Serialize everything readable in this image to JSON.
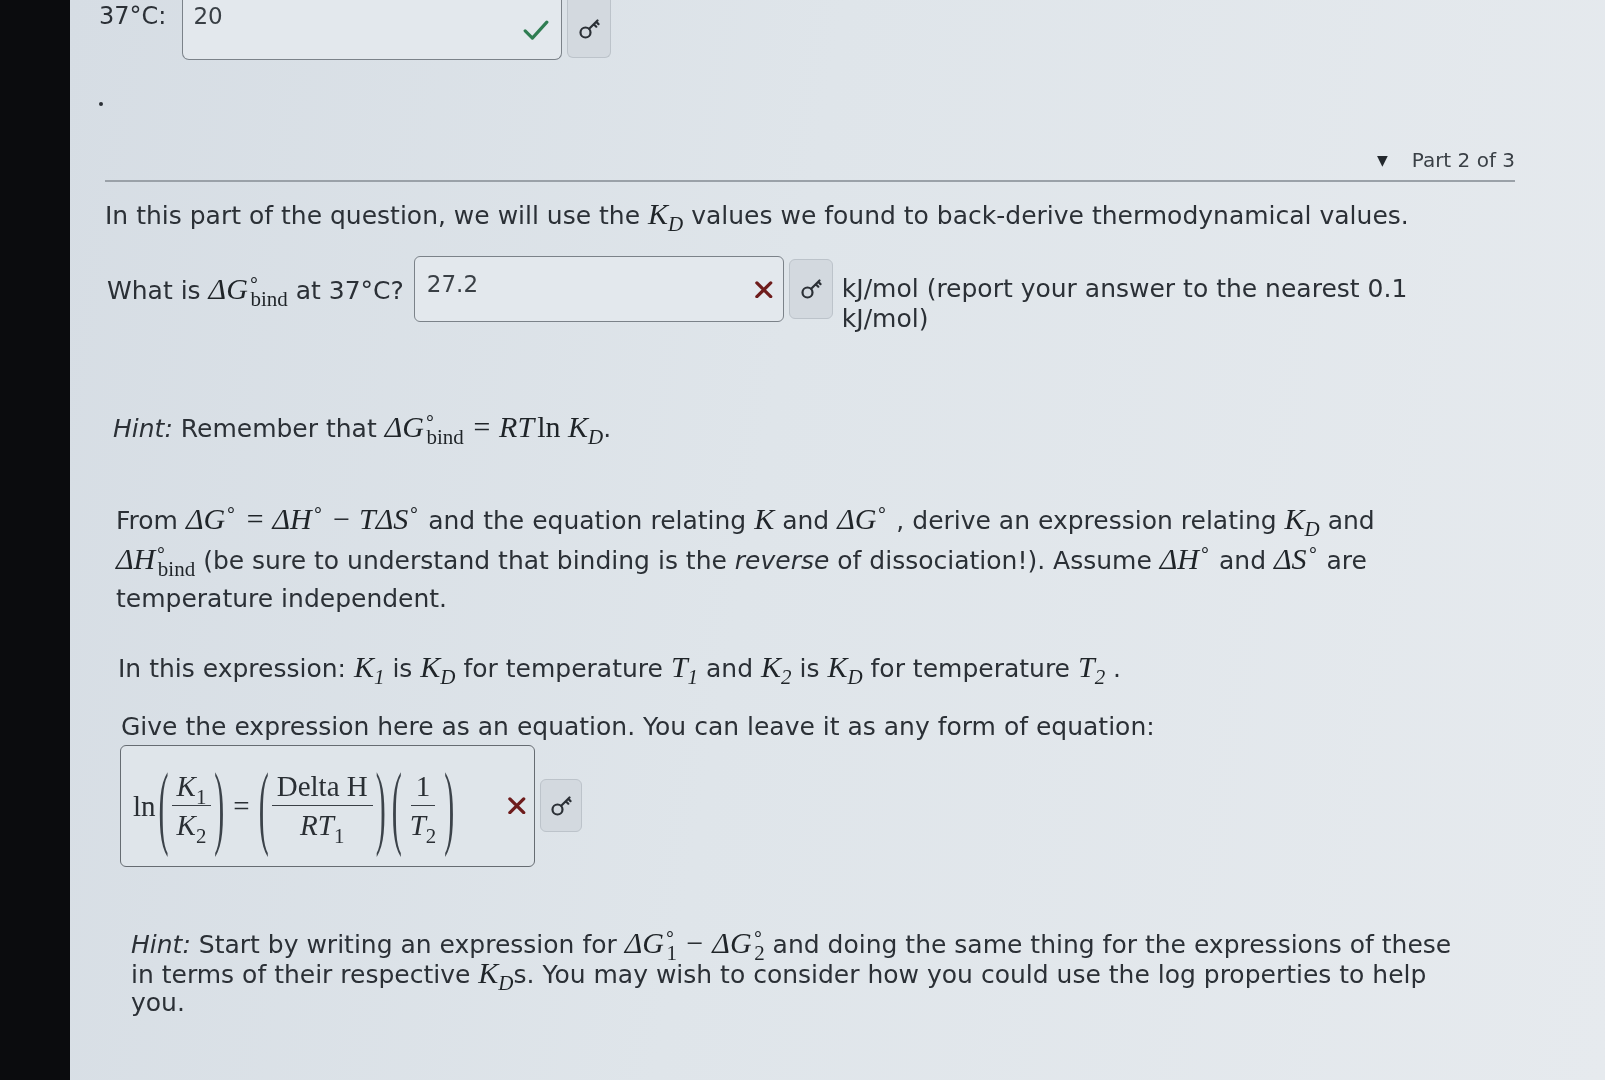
{
  "previous_answer": {
    "label": "37°C:",
    "value": "20",
    "correct": true
  },
  "part_header": {
    "toggle": "▼",
    "label": "Part 2 of 3"
  },
  "intro": [
    {
      "kind": "text",
      "text": "In this part of the question, we will use the "
    },
    {
      "kind": "math",
      "text": "K$_{D}$"
    },
    {
      "kind": "text",
      "text": " values we found to back-derive thermodynamical values."
    }
  ],
  "question": {
    "prompt": [
      {
        "kind": "text",
        "text": "What is "
      },
      {
        "kind": "math",
        "text": "ΔG$^{∘}$$_{bind}$"
      },
      {
        "kind": "text",
        "text": " at 37°C?"
      }
    ],
    "answer": {
      "value": "27.2",
      "correct": false
    },
    "unit_note": "kJ/mol (report your answer to the nearest 0.1 kJ/mol)"
  },
  "hint_1": [
    {
      "kind": "emphasis",
      "text": "Hint:"
    },
    {
      "kind": "text",
      "text": " Remember that "
    },
    {
      "kind": "math",
      "text": "ΔG$^{∘}$$_{bind}$ = RT"
    },
    {
      "kind": "function",
      "text": "ln"
    },
    {
      "kind": "math",
      "text": "K$_{D}$"
    },
    {
      "kind": "text",
      "text": "."
    }
  ],
  "task": [
    {
      "kind": "text",
      "text": "From "
    },
    {
      "kind": "math",
      "text": "ΔG$^{∘}$ = ΔH$^{∘}$ − TΔS$^{∘}$"
    },
    {
      "kind": "text",
      "text": " and the equation relating "
    },
    {
      "kind": "math",
      "text": "K"
    },
    {
      "kind": "text",
      "text": " and "
    },
    {
      "kind": "math",
      "text": "ΔG$^{∘}$"
    },
    {
      "kind": "text",
      "text": " , derive an expression relating "
    },
    {
      "kind": "math",
      "text": "K$_{D}$"
    },
    {
      "kind": "text",
      "text": " and "
    },
    {
      "kind": "math",
      "text": "ΔH$^{∘}$$_{bind}$"
    },
    {
      "kind": "text",
      "text": " (be sure to understand that binding is the "
    },
    {
      "kind": "emphasis",
      "text": "reverse"
    },
    {
      "kind": "text",
      "text": " of dissociation!). Assume "
    },
    {
      "kind": "math",
      "text": "ΔH$^{∘}$"
    },
    {
      "kind": "text",
      "text": " and "
    },
    {
      "kind": "math",
      "text": "ΔS$^{∘}$"
    },
    {
      "kind": "text",
      "text": " are temperature independent."
    }
  ],
  "definitions": [
    {
      "kind": "text",
      "text": "In this expression: "
    },
    {
      "kind": "math",
      "text": "K$_{1}$"
    },
    {
      "kind": "text",
      "text": " is "
    },
    {
      "kind": "math",
      "text": "K$_{D}$"
    },
    {
      "kind": "text",
      "text": " for temperature "
    },
    {
      "kind": "math",
      "text": "T$_{1}$"
    },
    {
      "kind": "text",
      "text": " and "
    },
    {
      "kind": "math",
      "text": "K$_{2}$"
    },
    {
      "kind": "text",
      "text": " is "
    },
    {
      "kind": "math",
      "text": "K$_{D}$"
    },
    {
      "kind": "text",
      "text": " for temperature "
    },
    {
      "kind": "math",
      "text": "T$_{2}$"
    },
    {
      "kind": "text",
      "text": " ."
    }
  ],
  "equation_prompt": "Give the expression here as an equation. You can leave it as any form of equation:",
  "expression_answer": {
    "parts": [
      {
        "kind": "function",
        "text": "ln"
      },
      {
        "kind": "group",
        "open": "(",
        "numerator": "*K*$_{1}$",
        "denominator": "*K*$_{2}$",
        "close": ")"
      },
      {
        "kind": "operator",
        "text": "="
      },
      {
        "kind": "group",
        "open": "(",
        "numerator": "Delta H",
        "denominator": "*RT*$_{1}$",
        "close": ")"
      },
      {
        "kind": "group",
        "open": "(",
        "numerator": "1",
        "denominator": "*T*$_{2}$",
        "close": ")"
      }
    ],
    "correct": false
  },
  "hint_2": [
    {
      "kind": "emphasis",
      "text": "Hint:"
    },
    {
      "kind": "text",
      "text": " Start by writing an expression for "
    },
    {
      "kind": "math",
      "text": "ΔG$^{∘}$$_{1}$ − ΔG$^{∘}$$_{2}$"
    },
    {
      "kind": "text",
      "text": " and doing the same thing for the expressions of these in terms of their respective "
    },
    {
      "kind": "math",
      "text": "K$_{D}$"
    },
    {
      "kind": "text",
      "text": "s. You may wish to consider how you could use the log properties to help you."
    }
  ]
}
